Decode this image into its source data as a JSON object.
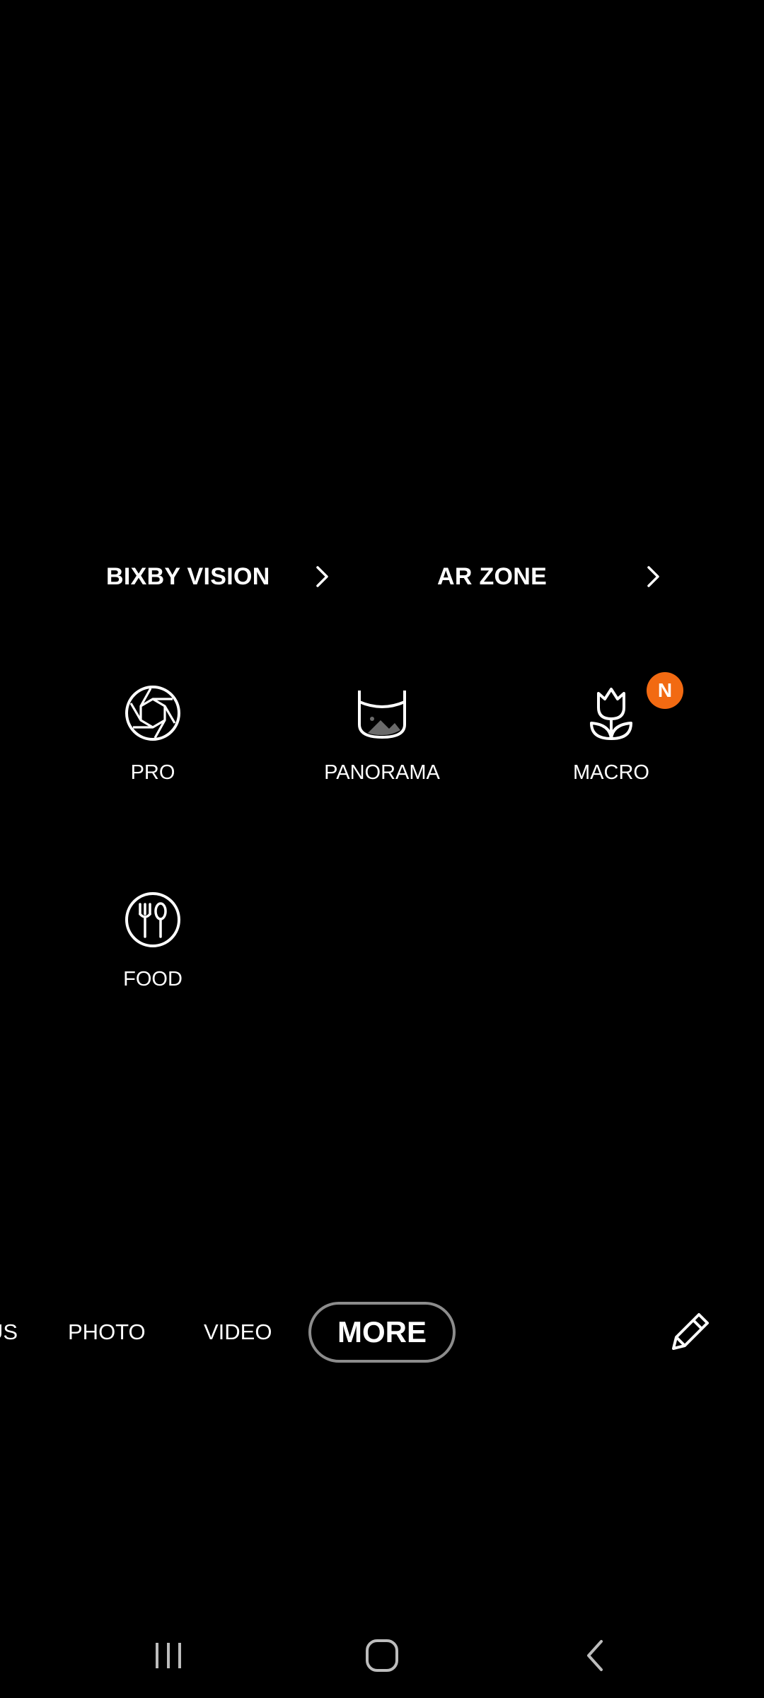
{
  "shortcuts": {
    "bixby_vision": "BIXBY VISION",
    "ar_zone": "AR ZONE"
  },
  "modes": [
    {
      "label": "PRO",
      "icon": "aperture-icon"
    },
    {
      "label": "PANORAMA",
      "icon": "panorama-icon"
    },
    {
      "label": "MACRO",
      "icon": "tulip-icon",
      "badge": "N"
    },
    {
      "label": "FOOD",
      "icon": "fork-spoon-icon"
    }
  ],
  "mode_bar": {
    "partial_left": "US",
    "photo": "PHOTO",
    "video": "VIDEO",
    "more": "MORE",
    "edit_icon": "pencil-icon"
  },
  "nav": {
    "recents_icon": "recents-icon",
    "home_icon": "home-icon",
    "back_icon": "back-icon"
  },
  "colors": {
    "background": "#000000",
    "badge": "#f26a12",
    "active_tab_border": "#8c8c8c"
  }
}
